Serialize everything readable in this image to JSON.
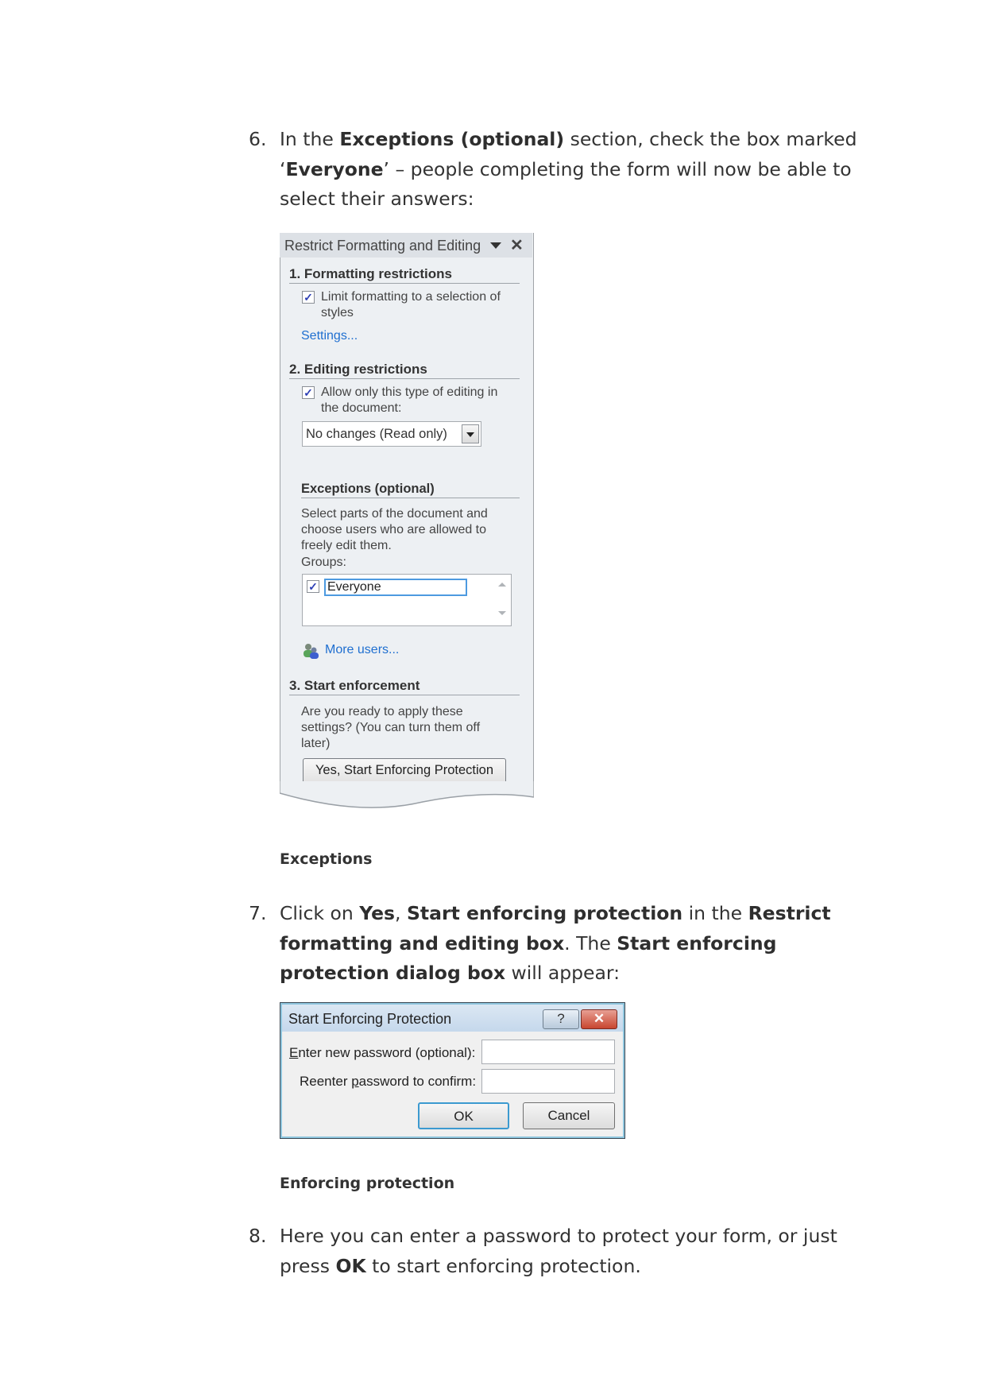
{
  "steps": [
    {
      "number": "6.",
      "segments": [
        {
          "text": "In the ",
          "bold": false
        },
        {
          "text": "Exceptions (optional)",
          "bold": true
        },
        {
          "text": " section, check the box marked ‘",
          "bold": false
        },
        {
          "text": "Everyone",
          "bold": true
        },
        {
          "text": "’ – people completing the form will now be able to select their answers:",
          "bold": false
        }
      ]
    },
    {
      "number": "7.",
      "segments": [
        {
          "text": "Click on ",
          "bold": false
        },
        {
          "text": "Yes",
          "bold": true
        },
        {
          "text": ", ",
          "bold": false
        },
        {
          "text": "Start enforcing protection",
          "bold": true
        },
        {
          "text": " in the ",
          "bold": false
        },
        {
          "text": "Restrict formatting and editing box",
          "bold": true
        },
        {
          "text": ". The ",
          "bold": false
        },
        {
          "text": "Start enforcing protection dialog box",
          "bold": true
        },
        {
          "text": " will appear:",
          "bold": false
        }
      ]
    },
    {
      "number": "8.",
      "segments": [
        {
          "text": "Here you can enter a password to protect your form, or just press ",
          "bold": false
        },
        {
          "text": "OK",
          "bold": true
        },
        {
          "text": " to start enforcing protection.",
          "bold": false
        }
      ]
    }
  ],
  "captions": {
    "exceptions": "Exceptions",
    "enforcing": "Enforcing protection"
  },
  "panel": {
    "title": "Restrict Formatting and Editing",
    "dropdown_icon": "triangle-down",
    "close_icon": "x",
    "section1": {
      "heading": "1. Formatting restrictions",
      "checkbox_checked": true,
      "checkbox_label_line1": "Limit formatting to a selection of",
      "checkbox_label_line2": "styles",
      "settings_link": "Settings..."
    },
    "section2": {
      "heading": "2. Editing restrictions",
      "checkbox_checked": true,
      "checkbox_label_line1": "Allow only this type of editing in",
      "checkbox_label_line2": "the document:",
      "select_value": "No changes (Read only)",
      "exceptions_heading": "Exceptions (optional)",
      "exceptions_desc_line1": "Select parts of the document and",
      "exceptions_desc_line2": "choose users who are allowed to",
      "exceptions_desc_line3": "freely edit them.",
      "groups_label": "Groups:",
      "groups": [
        {
          "name": "Everyone",
          "checked": true
        }
      ],
      "more_users_link": "More users..."
    },
    "section3": {
      "heading": "3. Start enforcement",
      "desc_line1": "Are you ready to apply these",
      "desc_line2": "settings? (You can turn them off",
      "desc_line3": "later)",
      "button": "Yes, Start Enforcing Protection"
    }
  },
  "dialog": {
    "title": "Start Enforcing Protection",
    "help_icon": "?",
    "close_icon": "x",
    "password_label_accel": "E",
    "password_label_rest": "nter new password (optional):",
    "password_value": "",
    "confirm_label_pre": "Reenter ",
    "confirm_label_accel": "p",
    "confirm_label_rest": "assword to confirm:",
    "confirm_value": "",
    "ok": "OK",
    "cancel": "Cancel"
  },
  "colors": {
    "link": "#1f6fd0",
    "checkmark": "#2d3fb5",
    "focus": "#4d9ae0",
    "close_red": "#c8452f"
  }
}
